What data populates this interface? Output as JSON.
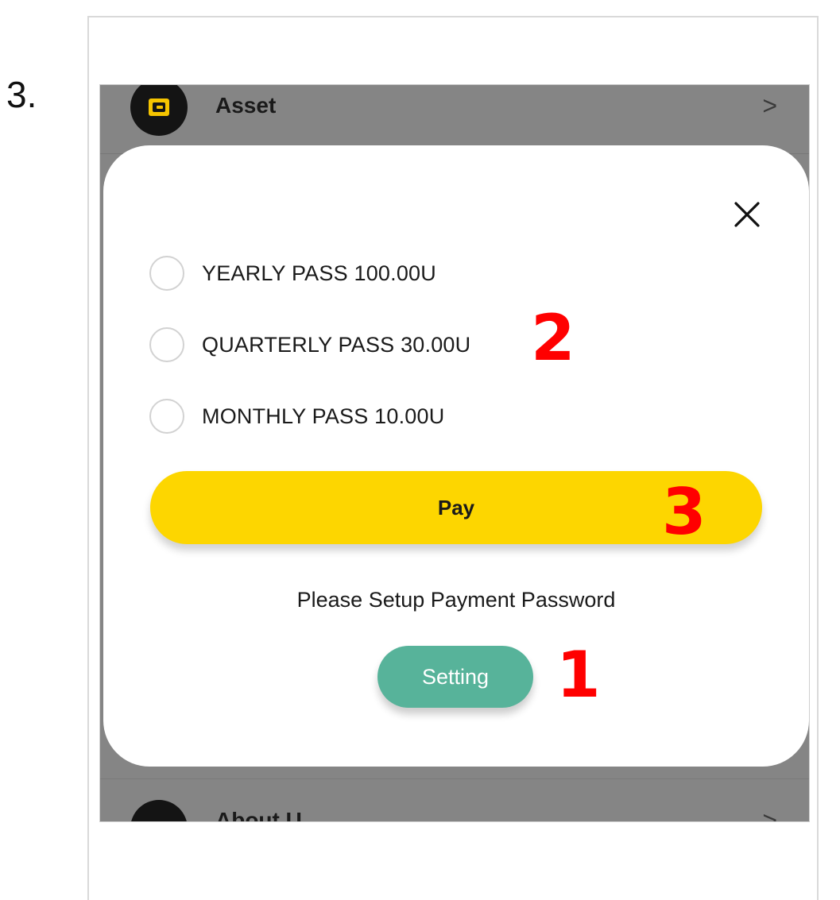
{
  "step_label": "3.",
  "background_list": {
    "asset": {
      "label": "Asset",
      "chevron": ">",
      "icon": "wallet-icon"
    },
    "about": {
      "label": "About U",
      "chevron": ">"
    }
  },
  "modal": {
    "close_icon": "close-icon",
    "options": [
      {
        "label": "YEARLY PASS 100.00U",
        "selected": false
      },
      {
        "label": "QUARTERLY PASS 30.00U",
        "selected": false
      },
      {
        "label": "MONTHLY PASS 10.00U",
        "selected": false
      }
    ],
    "pay_label": "Pay",
    "setup_text": "Please Setup Payment Password",
    "setting_label": "Setting"
  },
  "annotations": {
    "one": "1",
    "two": "2",
    "three": "3"
  },
  "colors": {
    "pay_button": "#fdd600",
    "setting_button": "#57b39a",
    "annotation": "#ff0000",
    "overlay": "#858585"
  }
}
